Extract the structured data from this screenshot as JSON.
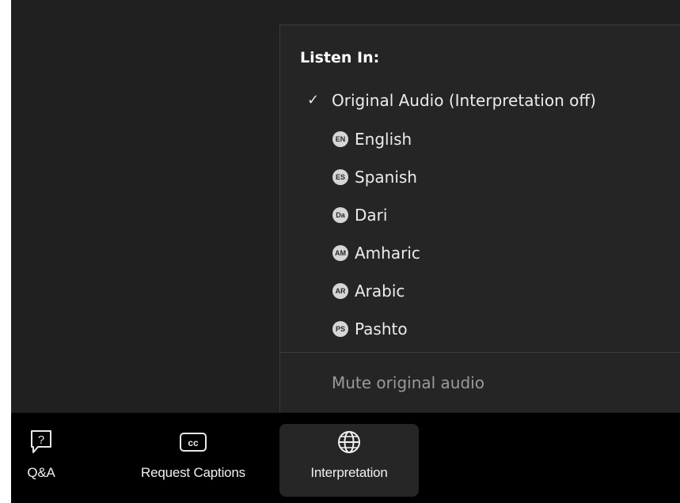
{
  "menu": {
    "heading": "Listen In:",
    "original_audio": {
      "label": "Original Audio (Interpretation off)",
      "checked": true
    },
    "languages": [
      {
        "code": "EN",
        "name": "English"
      },
      {
        "code": "ES",
        "name": "Spanish"
      },
      {
        "code": "Da",
        "name": "Dari"
      },
      {
        "code": "AM",
        "name": "Amharic"
      },
      {
        "code": "AR",
        "name": "Arabic"
      },
      {
        "code": "PS",
        "name": "Pashto"
      }
    ],
    "mute_label": "Mute original audio"
  },
  "toolbar": {
    "qa": {
      "label": "Q&A",
      "icon": "qa-question-icon"
    },
    "captions": {
      "label": "Request Captions",
      "icon": "closed-captions-icon"
    },
    "interpretation": {
      "label": "Interpretation",
      "icon": "globe-icon",
      "active": true
    }
  },
  "colors": {
    "background": "#202020",
    "menu_bg": "#252525",
    "toolbar_bg": "#000000",
    "active_tool_bg": "#262626",
    "badge_bg": "#d6d6d6",
    "muted_text": "#9a9a9a"
  }
}
